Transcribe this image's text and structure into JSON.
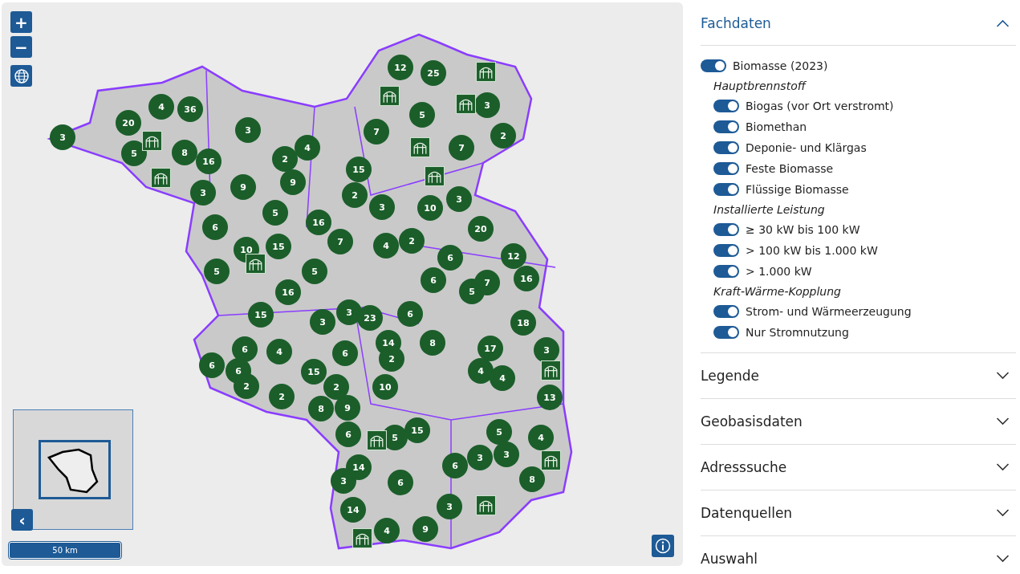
{
  "map": {
    "zoom_in": "+",
    "zoom_out": "−",
    "collapse_overview": "‹",
    "scale": "50 km",
    "markers": [
      {
        "kind": "cluster",
        "count": "3"
      },
      {
        "kind": "cluster",
        "count": "20"
      },
      {
        "kind": "cluster",
        "count": "4"
      },
      {
        "kind": "cluster",
        "count": "36"
      },
      {
        "kind": "cluster",
        "count": "5"
      },
      {
        "kind": "cluster",
        "count": "8"
      },
      {
        "kind": "cluster",
        "count": "16"
      },
      {
        "kind": "cluster",
        "count": "3"
      },
      {
        "kind": "cluster",
        "count": "4"
      },
      {
        "kind": "cluster",
        "count": "2"
      },
      {
        "kind": "cluster",
        "count": "3"
      },
      {
        "kind": "cluster",
        "count": "9"
      },
      {
        "kind": "cluster",
        "count": "9"
      },
      {
        "kind": "cluster",
        "count": "15"
      },
      {
        "kind": "cluster",
        "count": "2"
      },
      {
        "kind": "cluster",
        "count": "5"
      },
      {
        "kind": "cluster",
        "count": "16"
      },
      {
        "kind": "cluster",
        "count": "6"
      },
      {
        "kind": "cluster",
        "count": "10"
      },
      {
        "kind": "cluster",
        "count": "15"
      },
      {
        "kind": "cluster",
        "count": "7"
      },
      {
        "kind": "cluster",
        "count": "5"
      },
      {
        "kind": "cluster",
        "count": "5"
      },
      {
        "kind": "cluster",
        "count": "16"
      },
      {
        "kind": "cluster",
        "count": "12"
      },
      {
        "kind": "cluster",
        "count": "25"
      },
      {
        "kind": "cluster",
        "count": "5"
      },
      {
        "kind": "cluster",
        "count": "3"
      },
      {
        "kind": "cluster",
        "count": "2"
      },
      {
        "kind": "cluster",
        "count": "7"
      },
      {
        "kind": "cluster",
        "count": "7"
      },
      {
        "kind": "cluster",
        "count": "3"
      },
      {
        "kind": "cluster",
        "count": "10"
      },
      {
        "kind": "cluster",
        "count": "3"
      },
      {
        "kind": "cluster",
        "count": "20"
      },
      {
        "kind": "cluster",
        "count": "4"
      },
      {
        "kind": "cluster",
        "count": "2"
      },
      {
        "kind": "cluster",
        "count": "6"
      },
      {
        "kind": "cluster",
        "count": "12"
      },
      {
        "kind": "cluster",
        "count": "6"
      },
      {
        "kind": "cluster",
        "count": "5"
      },
      {
        "kind": "cluster",
        "count": "7"
      },
      {
        "kind": "cluster",
        "count": "16"
      },
      {
        "kind": "cluster",
        "count": "15"
      },
      {
        "kind": "cluster",
        "count": "3"
      },
      {
        "kind": "cluster",
        "count": "3"
      },
      {
        "kind": "cluster",
        "count": "23"
      },
      {
        "kind": "cluster",
        "count": "6"
      },
      {
        "kind": "cluster",
        "count": "18"
      },
      {
        "kind": "cluster",
        "count": "6"
      },
      {
        "kind": "cluster",
        "count": "4"
      },
      {
        "kind": "cluster",
        "count": "6"
      },
      {
        "kind": "cluster",
        "count": "6"
      },
      {
        "kind": "cluster",
        "count": "2"
      },
      {
        "kind": "cluster",
        "count": "2"
      },
      {
        "kind": "cluster",
        "count": "15"
      },
      {
        "kind": "cluster",
        "count": "6"
      },
      {
        "kind": "cluster",
        "count": "14"
      },
      {
        "kind": "cluster",
        "count": "2"
      },
      {
        "kind": "cluster",
        "count": "8"
      },
      {
        "kind": "cluster",
        "count": "2"
      },
      {
        "kind": "cluster",
        "count": "8"
      },
      {
        "kind": "cluster",
        "count": "9"
      },
      {
        "kind": "cluster",
        "count": "10"
      },
      {
        "kind": "cluster",
        "count": "17"
      },
      {
        "kind": "cluster",
        "count": "3"
      },
      {
        "kind": "cluster",
        "count": "4"
      },
      {
        "kind": "cluster",
        "count": "4"
      },
      {
        "kind": "cluster",
        "count": "13"
      },
      {
        "kind": "cluster",
        "count": "6"
      },
      {
        "kind": "cluster",
        "count": "5"
      },
      {
        "kind": "cluster",
        "count": "15"
      },
      {
        "kind": "cluster",
        "count": "14"
      },
      {
        "kind": "cluster",
        "count": "3"
      },
      {
        "kind": "cluster",
        "count": "6"
      },
      {
        "kind": "cluster",
        "count": "6"
      },
      {
        "kind": "cluster",
        "count": "3"
      },
      {
        "kind": "cluster",
        "count": "3"
      },
      {
        "kind": "cluster",
        "count": "5"
      },
      {
        "kind": "cluster",
        "count": "4"
      },
      {
        "kind": "cluster",
        "count": "8"
      },
      {
        "kind": "cluster",
        "count": "3"
      },
      {
        "kind": "cluster",
        "count": "14"
      },
      {
        "kind": "cluster",
        "count": "4"
      },
      {
        "kind": "cluster",
        "count": "9"
      },
      {
        "kind": "site"
      },
      {
        "kind": "site"
      },
      {
        "kind": "site"
      },
      {
        "kind": "site"
      },
      {
        "kind": "site"
      },
      {
        "kind": "site"
      },
      {
        "kind": "site"
      },
      {
        "kind": "site"
      },
      {
        "kind": "site"
      },
      {
        "kind": "site"
      },
      {
        "kind": "site"
      },
      {
        "kind": "site"
      },
      {
        "kind": "site"
      }
    ]
  },
  "panel": {
    "sections": [
      {
        "title": "Fachdaten",
        "expanded": true
      },
      {
        "title": "Legende",
        "expanded": false
      },
      {
        "title": "Geobasisdaten",
        "expanded": false
      },
      {
        "title": "Adresssuche",
        "expanded": false
      },
      {
        "title": "Datenquellen",
        "expanded": false
      },
      {
        "title": "Auswahl",
        "expanded": false
      }
    ],
    "layer": {
      "label": "Biomasse (2023)",
      "on": true
    },
    "groups": [
      {
        "heading": "Hauptbrennstoff",
        "items": [
          {
            "label": "Biogas (vor Ort verstromt)",
            "on": true
          },
          {
            "label": "Biomethan",
            "on": true
          },
          {
            "label": "Deponie- und Klärgas",
            "on": true
          },
          {
            "label": "Feste Biomasse",
            "on": true
          },
          {
            "label": "Flüssige Biomasse",
            "on": true
          }
        ]
      },
      {
        "heading": "Installierte Leistung",
        "items": [
          {
            "label": "≥ 30 kW bis 100 kW",
            "on": true
          },
          {
            "label": "> 100 kW bis 1.000 kW",
            "on": true
          },
          {
            "label": "> 1.000 kW",
            "on": true
          }
        ]
      },
      {
        "heading": "Kraft-Wärme-Kopplung",
        "items": [
          {
            "label": "Strom- und Wärmeerzeugung",
            "on": true
          },
          {
            "label": "Nur Stromnutzung",
            "on": true
          }
        ]
      }
    ]
  }
}
